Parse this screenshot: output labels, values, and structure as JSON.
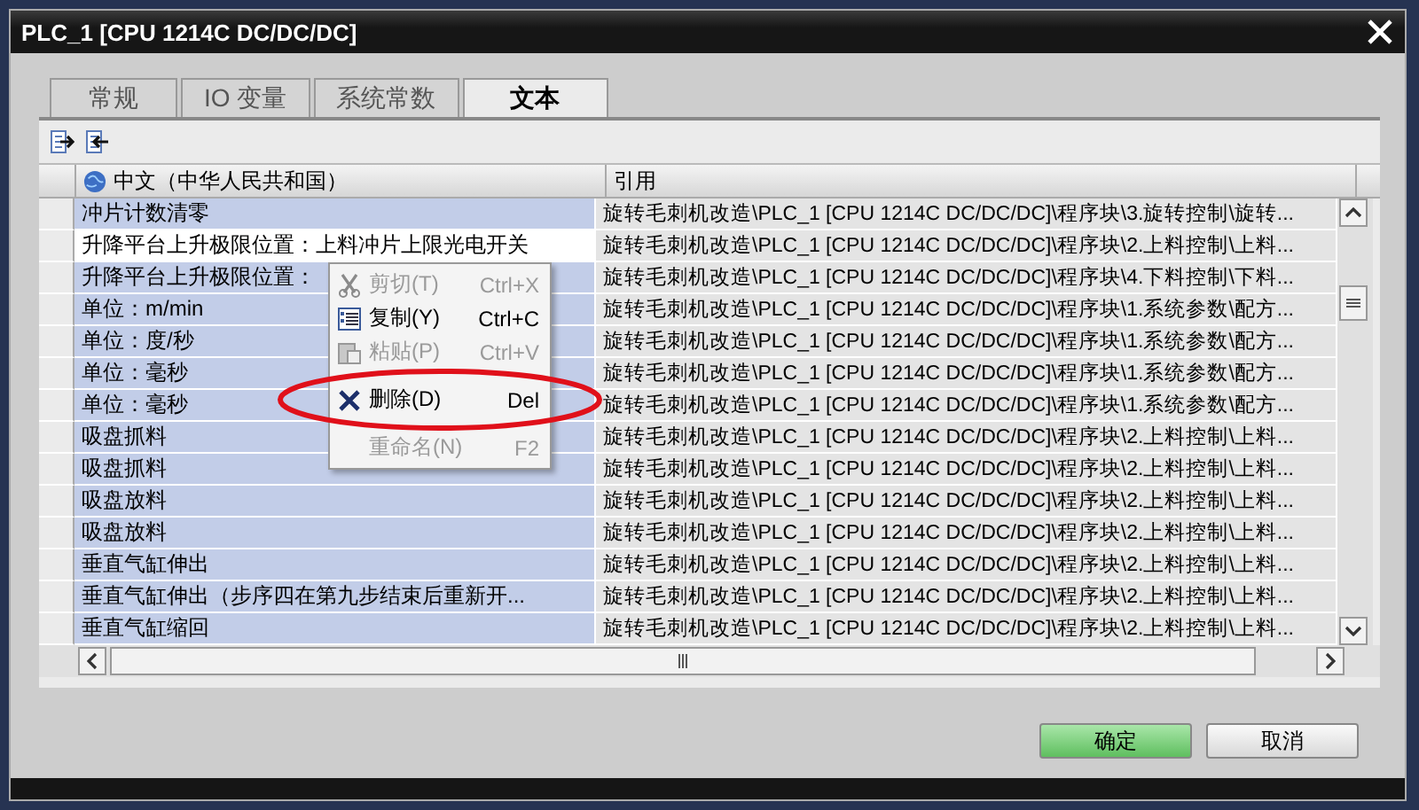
{
  "window": {
    "title": "PLC_1 [CPU 1214C DC/DC/DC]"
  },
  "tabs": [
    {
      "label": "常规",
      "selected": false
    },
    {
      "label": "IO 变量",
      "selected": false
    },
    {
      "label": "系统常数",
      "selected": false
    },
    {
      "label": "文本",
      "selected": true
    }
  ],
  "table": {
    "columns": [
      "中文（中华人民共和国）",
      "引用"
    ],
    "rows": [
      {
        "text": "冲片计数清零",
        "reference": "旋转毛刺机改造\\PLC_1 [CPU 1214C DC/DC/DC]\\程序块\\3.旋转控制\\旋转...",
        "selected": false
      },
      {
        "text": "升降平台上升极限位置：上料冲片上限光电开关",
        "reference": "旋转毛刺机改造\\PLC_1 [CPU 1214C DC/DC/DC]\\程序块\\2.上料控制\\上料...",
        "selected": true
      },
      {
        "text": "升降平台上升极限位置：",
        "reference": "旋转毛刺机改造\\PLC_1 [CPU 1214C DC/DC/DC]\\程序块\\4.下料控制\\下料...",
        "selected": false
      },
      {
        "text": "单位：m/min",
        "reference": "旋转毛刺机改造\\PLC_1 [CPU 1214C DC/DC/DC]\\程序块\\1.系统参数\\配方...",
        "selected": false
      },
      {
        "text": "单位：度/秒",
        "reference": "旋转毛刺机改造\\PLC_1 [CPU 1214C DC/DC/DC]\\程序块\\1.系统参数\\配方...",
        "selected": false
      },
      {
        "text": "单位：毫秒",
        "reference": "旋转毛刺机改造\\PLC_1 [CPU 1214C DC/DC/DC]\\程序块\\1.系统参数\\配方...",
        "selected": false
      },
      {
        "text": "单位：毫秒",
        "reference": "旋转毛刺机改造\\PLC_1 [CPU 1214C DC/DC/DC]\\程序块\\1.系统参数\\配方...",
        "selected": false
      },
      {
        "text": "吸盘抓料",
        "reference": "旋转毛刺机改造\\PLC_1 [CPU 1214C DC/DC/DC]\\程序块\\2.上料控制\\上料...",
        "selected": false
      },
      {
        "text": "吸盘抓料",
        "reference": "旋转毛刺机改造\\PLC_1 [CPU 1214C DC/DC/DC]\\程序块\\2.上料控制\\上料...",
        "selected": false
      },
      {
        "text": "吸盘放料",
        "reference": "旋转毛刺机改造\\PLC_1 [CPU 1214C DC/DC/DC]\\程序块\\2.上料控制\\上料...",
        "selected": false
      },
      {
        "text": "吸盘放料",
        "reference": "旋转毛刺机改造\\PLC_1 [CPU 1214C DC/DC/DC]\\程序块\\2.上料控制\\上料...",
        "selected": false
      },
      {
        "text": "垂直气缸伸出",
        "reference": "旋转毛刺机改造\\PLC_1 [CPU 1214C DC/DC/DC]\\程序块\\2.上料控制\\上料...",
        "selected": false
      },
      {
        "text": "垂直气缸伸出（步序四在第九步结束后重新开...",
        "reference": "旋转毛刺机改造\\PLC_1 [CPU 1214C DC/DC/DC]\\程序块\\2.上料控制\\上料...",
        "selected": false
      },
      {
        "text": "垂直气缸缩回",
        "reference": "旋转毛刺机改造\\PLC_1 [CPU 1214C DC/DC/DC]\\程序块\\2.上料控制\\上料...",
        "selected": false
      }
    ]
  },
  "context_menu": {
    "items": [
      {
        "kind": "cut",
        "label": "剪切(T)",
        "shortcut": "Ctrl+X",
        "disabled": true,
        "highlighted": false
      },
      {
        "kind": "copy",
        "label": "复制(Y)",
        "shortcut": "Ctrl+C",
        "disabled": false,
        "highlighted": false
      },
      {
        "kind": "paste",
        "label": "粘贴(P)",
        "shortcut": "Ctrl+V",
        "disabled": true,
        "highlighted": false
      },
      {
        "kind": "delete",
        "label": "删除(D)",
        "shortcut": "Del",
        "disabled": false,
        "highlighted": true
      },
      {
        "kind": "rename",
        "label": "重命名(N)",
        "shortcut": "F2",
        "disabled": true,
        "highlighted": false
      }
    ]
  },
  "buttons": [
    {
      "label": "确定",
      "kind": "primary"
    },
    {
      "label": "取消",
      "kind": "default"
    }
  ]
}
